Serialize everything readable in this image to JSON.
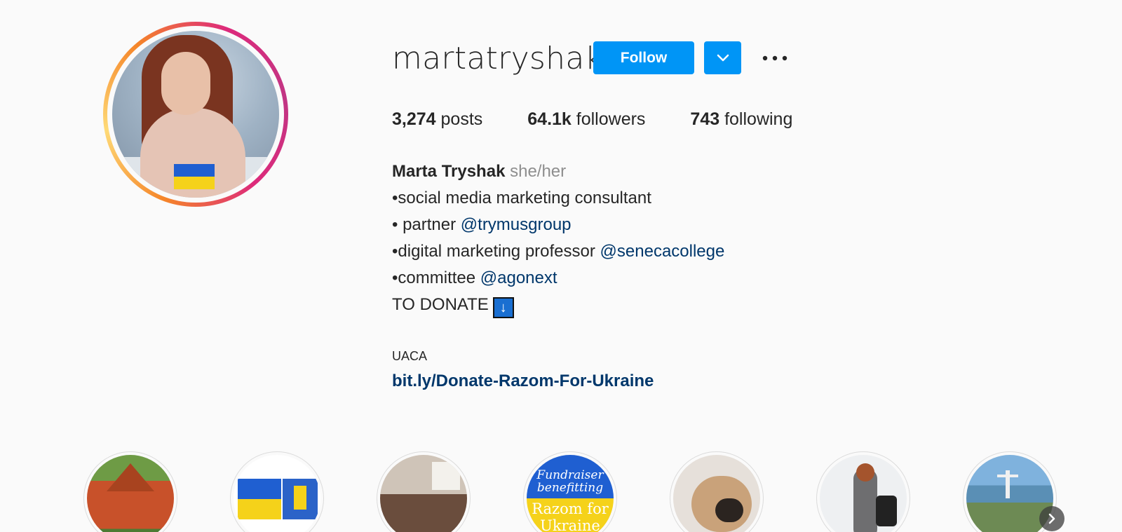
{
  "profile": {
    "username": "martatryshak",
    "follow_label": "Follow",
    "stats": {
      "posts_count": "3,274",
      "posts_label": " posts",
      "followers_count": "64.1k",
      "followers_label": " followers",
      "following_count": "743",
      "following_label": " following"
    },
    "bio": {
      "full_name": "Marta Tryshak",
      "pronouns": " she/her",
      "line1": "•social media marketing consultant",
      "line2_prefix": "• partner ",
      "line2_mention": "@trymusgroup",
      "line3_prefix": "•digital marketing professor ",
      "line3_mention": "@senecacollege",
      "line4_prefix": "•committee ",
      "line4_mention": "@agonext",
      "line5": "TO DONATE",
      "line5_emoji": "↓"
    },
    "category": "UACA",
    "link": "bit.ly/Donate-Razom-For-Ukraine"
  },
  "highlights": {
    "fundraiser_text": [
      "Fundraiser",
      "benefitting",
      "Razom for",
      "Ukraine"
    ]
  },
  "colors": {
    "accent": "#0095f6",
    "mention": "#00376b",
    "muted": "#8e8e8e",
    "ukraine_blue": "#1f5fd1",
    "ukraine_yellow": "#f5d21a"
  },
  "icons": {
    "dropdown": "chevron-down-icon",
    "more": "more-options-icon",
    "next": "chevron-right-icon"
  }
}
